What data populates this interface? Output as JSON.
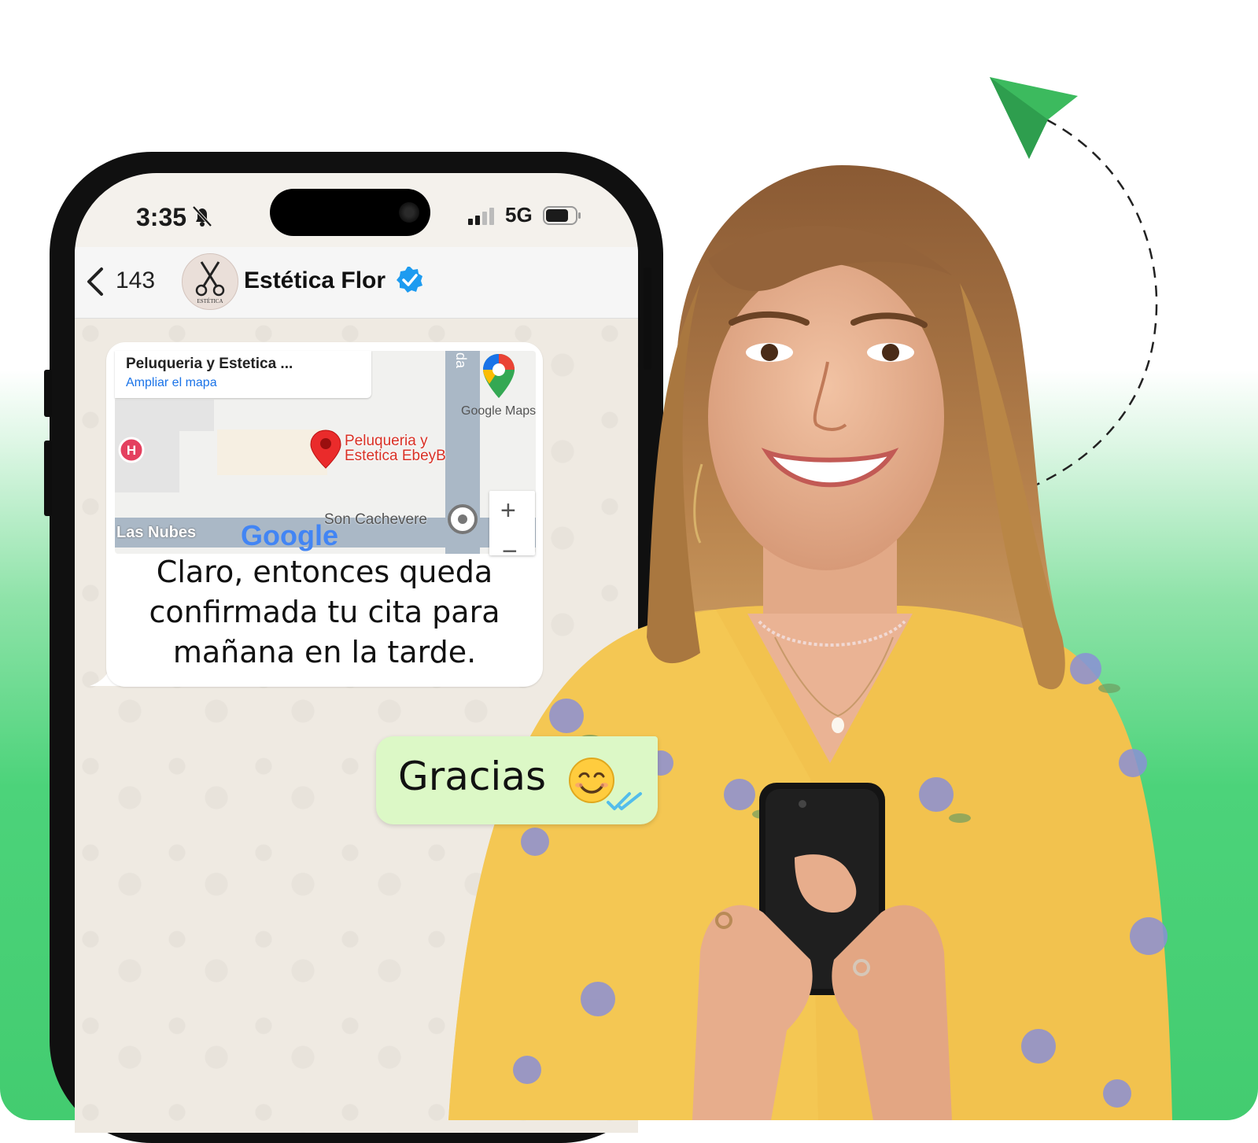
{
  "status_bar": {
    "time": "3:35",
    "network": "5G"
  },
  "chat_header": {
    "back_count": "143",
    "contact_name": "Estética Flor",
    "avatar_text": "ESTÉTICA"
  },
  "map": {
    "card_title": "Peluqueria y Estetica ...",
    "card_link": "Ampliar el mapa",
    "provider_label": "Google Maps",
    "street_label": "da",
    "place_name_line1": "Peluqueria y",
    "place_name_line2": "Estetica EbeyB",
    "area_label_1": "Son Cachevere",
    "area_label_2": "Las Nubes",
    "hospital_letter": "H",
    "zoom_in": "+",
    "zoom_out": "−",
    "logo_text": "Google"
  },
  "messages": {
    "incoming": "Claro, entonces queda confirmada tu cita para mañana en la tarde.",
    "outgoing": "Gracias"
  },
  "colors": {
    "accent_green": "#3cba5e",
    "outgoing_bubble": "#dcf8c6",
    "verified_blue": "#1d9bf0",
    "ticks_blue": "#53bdeb"
  }
}
